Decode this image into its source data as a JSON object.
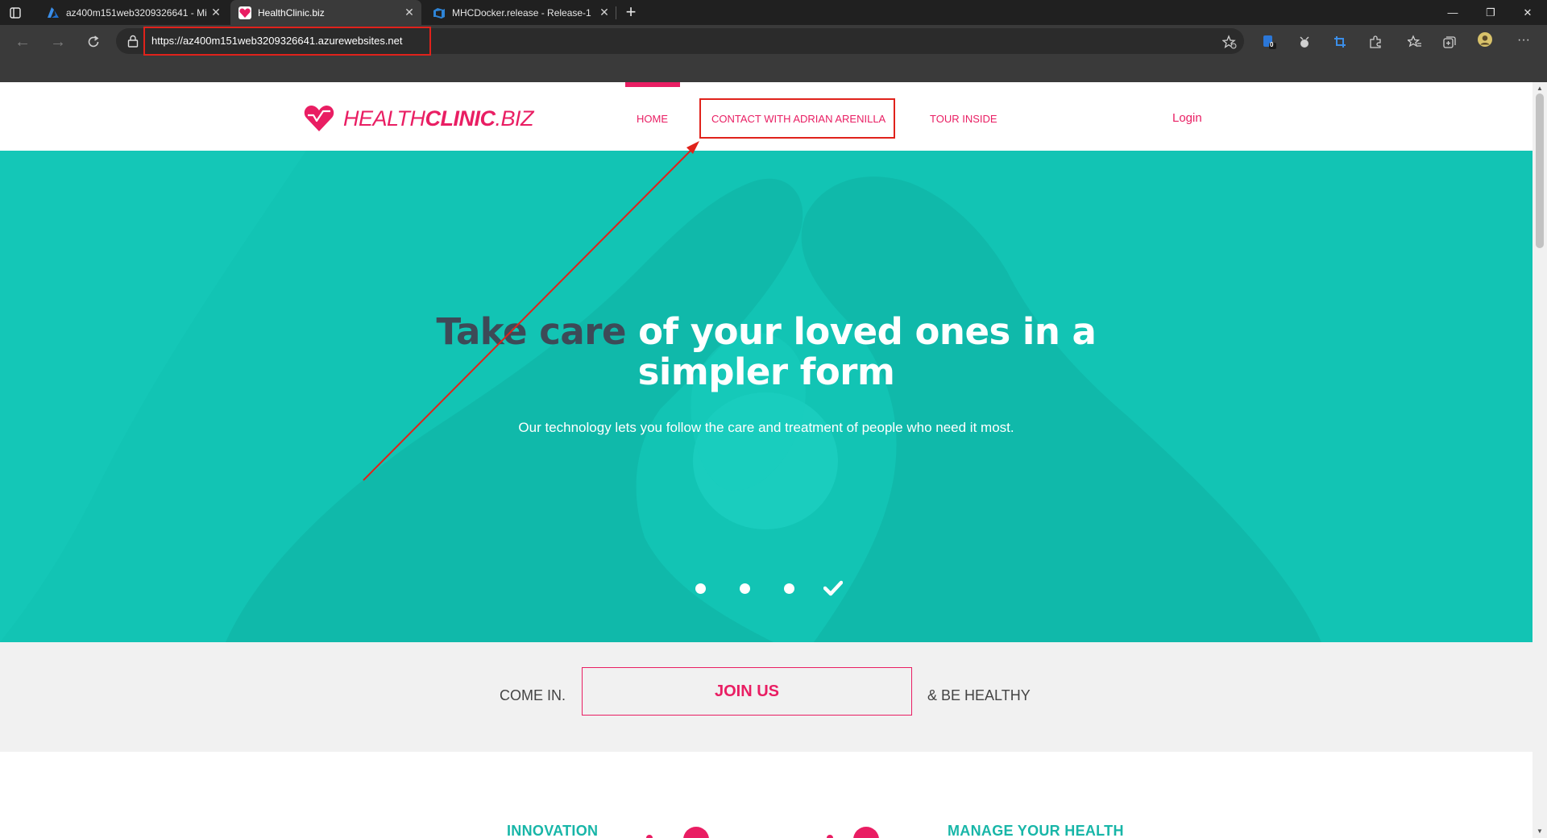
{
  "browser": {
    "tabs": [
      {
        "title": "az400m151web3209326641 - Mi",
        "favicon": "azure-icon",
        "active": false
      },
      {
        "title": "HealthClinic.biz",
        "favicon": "healthclinic-heart-icon",
        "active": true
      },
      {
        "title": "MHCDocker.release - Release-1",
        "favicon": "azure-devops-icon",
        "active": false
      }
    ],
    "new_tab_icon": "plus-icon",
    "window_controls": {
      "minimize": "—",
      "restore": "❐",
      "close": "✕"
    },
    "address": "https://az400m151web3209326641.azurewebsites.net",
    "extension_badge": "0"
  },
  "site": {
    "logo": {
      "part1": "HEALTH",
      "part2": "CLINIC",
      "part3": ".BIZ"
    },
    "nav": {
      "home": "HOME",
      "contact": "CONTACT WITH ADRIAN ARENILLA",
      "tour": "TOUR INSIDE",
      "login": "Login"
    },
    "hero": {
      "headline_dark": "Take care",
      "headline_rest": " of your loved ones in a simpler form",
      "subline": "Our technology lets you follow the care and treatment of people who need it most."
    },
    "join": {
      "left": "COME IN.",
      "button": "JOIN US",
      "right": "& BE HEALTHY"
    },
    "features": {
      "left_title": "INNOVATION",
      "right_title": "MANAGE YOUR HEALTH"
    }
  },
  "colors": {
    "brand_pink": "#e91e63",
    "hero_teal": "#12c4b4",
    "annotation_red": "#e0221b"
  }
}
